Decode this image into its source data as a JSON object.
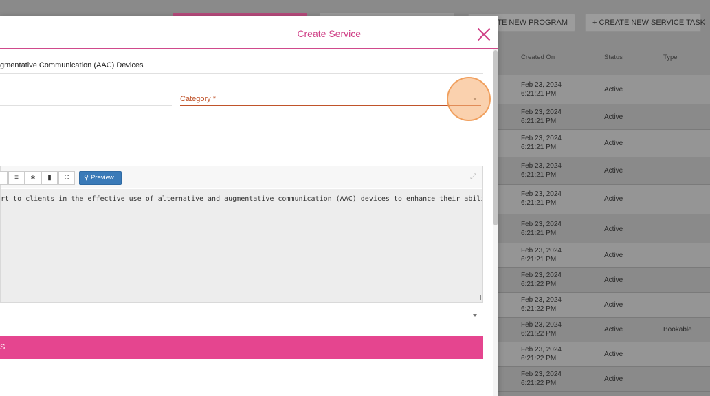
{
  "background": {
    "buttons": {
      "create_program": "ATE NEW PROGRAM",
      "create_service_task": "+ CREATE NEW SERVICE TASK"
    },
    "columns": [
      "Created On",
      "Status",
      "Type"
    ],
    "rows": [
      {
        "date": "Feb 23, 2024",
        "time": "6:21:21 PM",
        "status": "Active",
        "type": ""
      },
      {
        "date": "Feb 23, 2024",
        "time": "6:21:21 PM",
        "status": "Active",
        "type": ""
      },
      {
        "date": "Feb 23, 2024",
        "time": "6:21:21 PM",
        "status": "Active",
        "type": ""
      },
      {
        "date": "Feb 23, 2024",
        "time": "6:21:21 PM",
        "status": "Active",
        "type": ""
      },
      {
        "date": "Feb 23, 2024",
        "time": "6:21:21 PM",
        "status": "Active",
        "type": ""
      },
      {
        "date": "Feb 23, 2024",
        "time": "6:21:21 PM",
        "status": "Active",
        "type": ""
      },
      {
        "date": "Feb 23, 2024",
        "time": "6:21:21 PM",
        "status": "Active",
        "type": ""
      },
      {
        "date": "Feb 23, 2024",
        "time": "6:21:22 PM",
        "status": "Active",
        "type": ""
      },
      {
        "date": "Feb 23, 2024",
        "time": "6:21:22 PM",
        "status": "Active",
        "type": ""
      },
      {
        "date": "Feb 23, 2024",
        "time": "6:21:22 PM",
        "status": "Active",
        "type": "Bookable"
      },
      {
        "date": "Feb 23, 2024",
        "time": "6:21:22 PM",
        "status": "Active",
        "type": ""
      },
      {
        "date": "Feb 23, 2024",
        "time": "6:21:22 PM",
        "status": "Active",
        "type": ""
      }
    ]
  },
  "modal": {
    "title": "Create Service",
    "name_value": "gmentative Communication (AAC) Devices",
    "category_label": "Category *",
    "editor": {
      "toolbar_icons": [
        "italic-icon",
        "unordered-list-icon",
        "ordered-list-icon",
        "quote-icon",
        "table-icon"
      ],
      "preview_label": "Preview",
      "content": "rt to clients in the effective use of alternative and augmentative communication (AAC) devices to enhance their ability"
    },
    "pink_bar_text": "S"
  },
  "colors": {
    "accent": "#cf3f86",
    "pink_bar": "#e5458f",
    "category": "#c0532a",
    "preview": "#3a7ab8"
  }
}
